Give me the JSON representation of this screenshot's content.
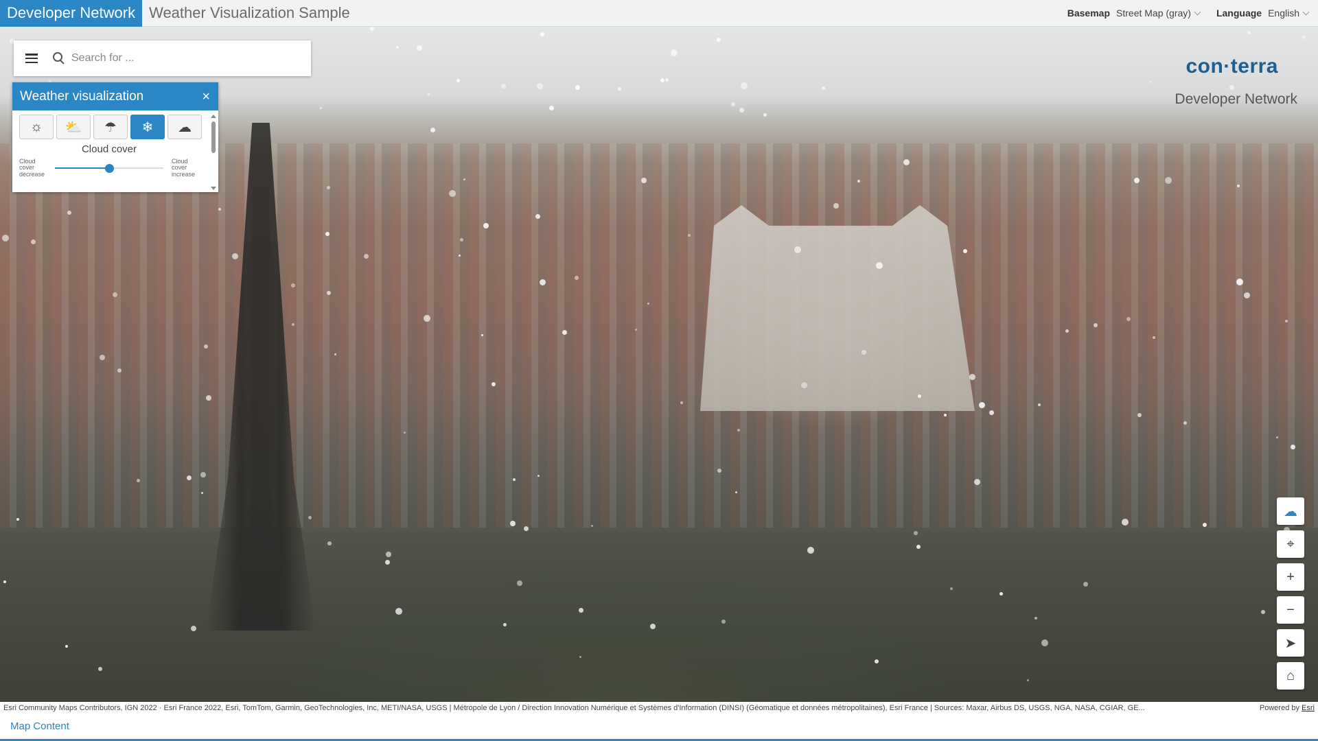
{
  "header": {
    "brand": "Developer Network",
    "title": "Weather Visualization Sample",
    "basemap_label": "Basemap",
    "basemap_value": "Street Map (gray)",
    "language_label": "Language",
    "language_value": "English"
  },
  "search": {
    "placeholder": "Search for ..."
  },
  "weather_panel": {
    "title": "Weather visualization",
    "close": "×",
    "weather_types": [
      {
        "name": "sunny",
        "icon": "sun-icon"
      },
      {
        "name": "cloudy",
        "icon": "cloud-sun-icon"
      },
      {
        "name": "rainy",
        "icon": "rain-icon"
      },
      {
        "name": "snowy",
        "icon": "snowflake-icon",
        "active": true
      },
      {
        "name": "foggy",
        "icon": "fog-icon"
      }
    ],
    "cloud_cover_title": "Cloud cover",
    "cloud_cover_decrease": "Cloud cover decrease",
    "cloud_cover_increase": "Cloud cover increase",
    "cloud_cover_value": 0.5
  },
  "logo": {
    "text": "con·terra",
    "subtitle": "Developer Network"
  },
  "controls": [
    {
      "name": "weather-toggle",
      "icon": "cloud-icon"
    },
    {
      "name": "locate",
      "icon": "crosshair-icon"
    },
    {
      "name": "zoom-in",
      "icon": "plus-icon"
    },
    {
      "name": "zoom-out",
      "icon": "minus-icon"
    },
    {
      "name": "compass",
      "icon": "compass-icon"
    },
    {
      "name": "home",
      "icon": "home-icon"
    }
  ],
  "attribution": {
    "text": "Esri Community Maps Contributors, IGN 2022 · Esri France 2022, Esri, TomTom, Garmin, GeoTechnologies, Inc, METI/NASA, USGS | Métropole de Lyon / Direction Innovation Numérique et Systèmes d'Information (DINSI) (Géomatique et données métropolitaines), Esri France | Sources: Maxar, Airbus DS, USGS, NGA, NASA, CGIAR, GE...",
    "powered_by": "Powered by",
    "esri": "Esri"
  },
  "bottom": {
    "map_content": "Map Content"
  },
  "colors": {
    "accent": "#2a86c5",
    "logo": "#1e5f8f"
  }
}
